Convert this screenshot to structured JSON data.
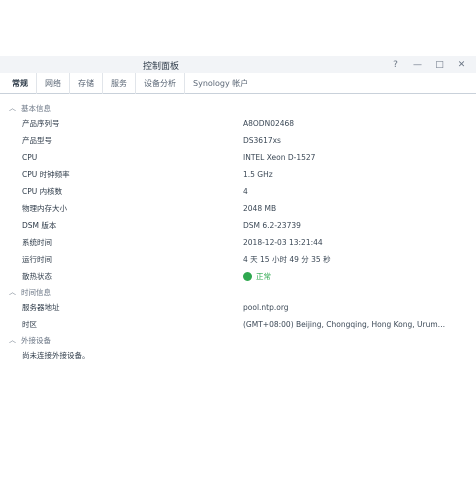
{
  "window": {
    "title": "控制面板",
    "controls": [
      "?",
      "—",
      "□",
      "✕"
    ]
  },
  "tabs": [
    {
      "label": "常规",
      "active": true
    },
    {
      "label": "网络",
      "active": false
    },
    {
      "label": "存储",
      "active": false
    },
    {
      "label": "服务",
      "active": false
    },
    {
      "label": "设备分析",
      "active": false
    },
    {
      "label": "Synology 帐户",
      "active": false
    }
  ],
  "basic_info": {
    "header": "基本信息",
    "rows": [
      {
        "label": "产品序列号",
        "value": "A8ODN02468"
      },
      {
        "label": "产品型号",
        "value": "DS3617xs"
      },
      {
        "label": "CPU",
        "value": "INTEL Xeon D-1527"
      },
      {
        "label": "CPU 时钟频率",
        "value": "1.5 GHz"
      },
      {
        "label": "CPU 内核数",
        "value": "4"
      },
      {
        "label": "物理内存大小",
        "value": "2048 MB"
      },
      {
        "label": "DSM 版本",
        "value": "DSM 6.2-23739"
      },
      {
        "label": "系统时间",
        "value": "2018-12-03 13:21:44"
      },
      {
        "label": "运行时间",
        "value": "4 天 15 小时 49 分 35 秒"
      }
    ],
    "thermal": {
      "label": "散热状态",
      "value": "正常",
      "color": "#2fa84f"
    }
  },
  "time_info": {
    "header": "时间信息",
    "rows": [
      {
        "label": "服务器地址",
        "value": "pool.ntp.org"
      },
      {
        "label": "时区",
        "value": "(GMT+08:00) Beijing, Chongqing, Hong Kong, Urum…"
      }
    ]
  },
  "external_devices": {
    "header": "外接设备",
    "note": "尚未连接外接设备。"
  }
}
